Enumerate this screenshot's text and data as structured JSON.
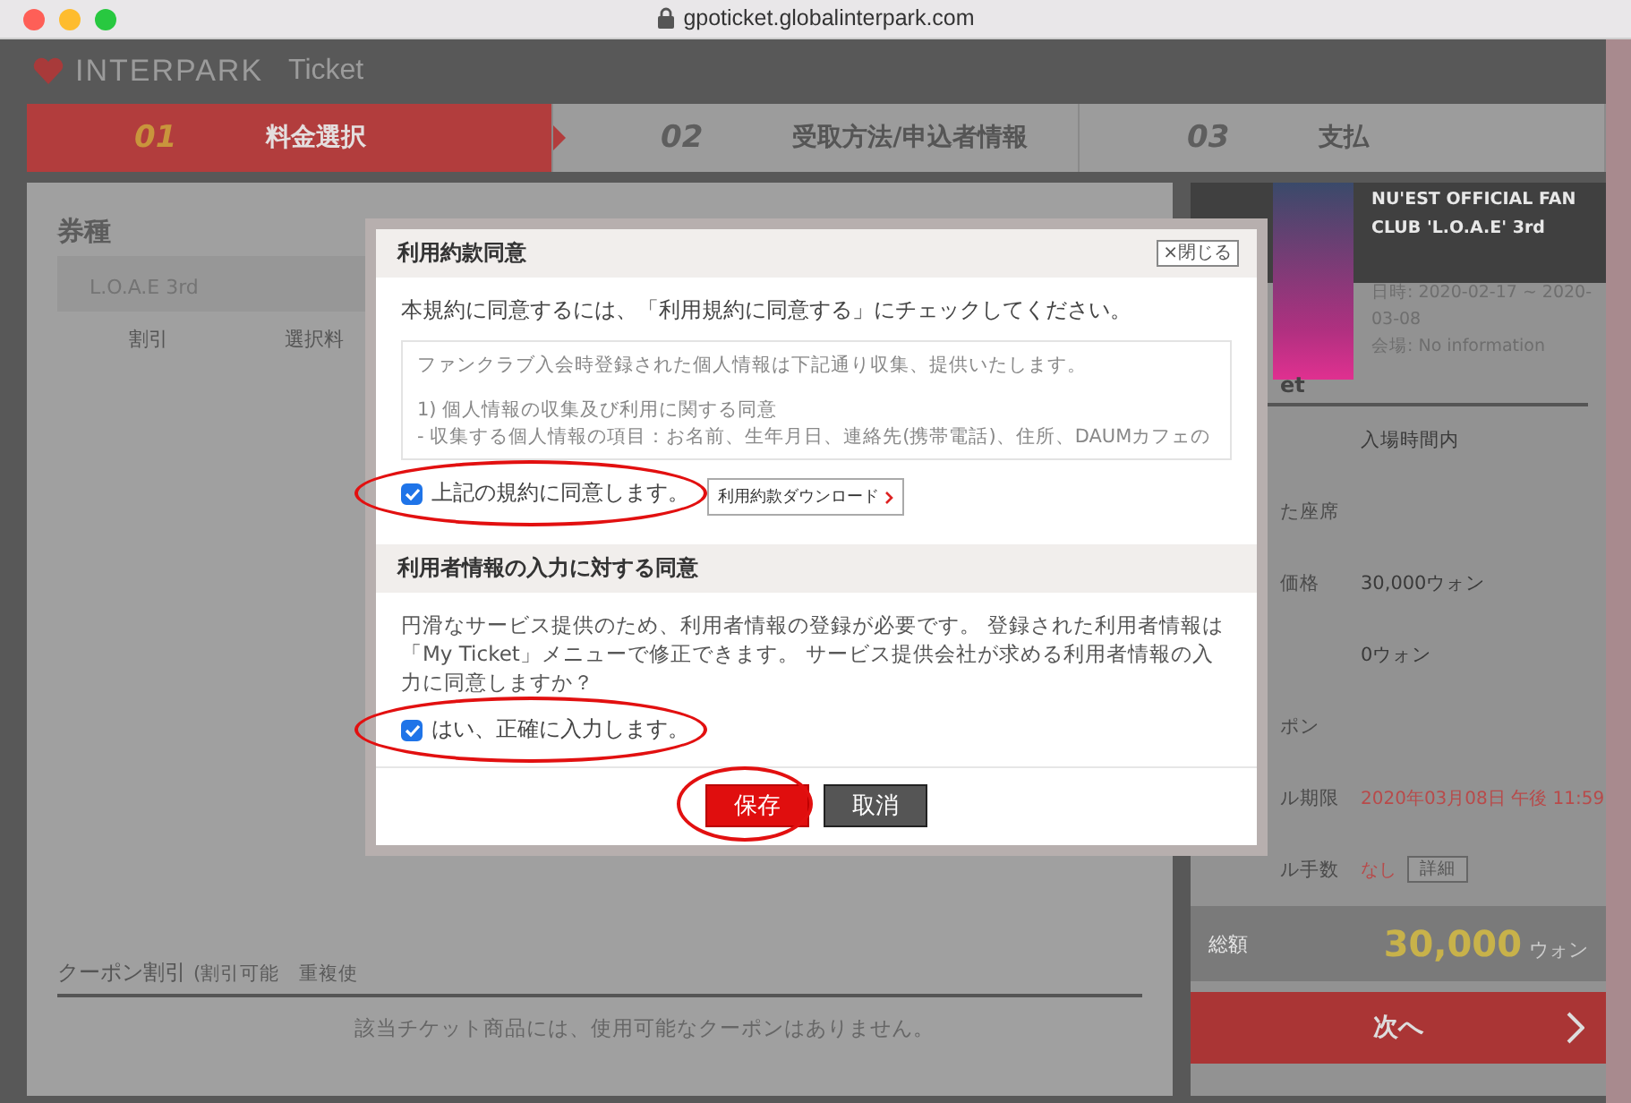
{
  "browser": {
    "url": "gpoticket.globalinterpark.com"
  },
  "header": {
    "logo": "INTERPARK",
    "logo_sub": "Ticket"
  },
  "steps": [
    {
      "number": "01",
      "label": "料金選択",
      "selected": true
    },
    {
      "number": "02",
      "label": "受取方法/申込者情報",
      "selected": false
    },
    {
      "number": "03",
      "label": "支払",
      "selected": false
    }
  ],
  "left_panel": {
    "title": "券種",
    "ticket_type": "L.O.A.E 3rd",
    "columns": [
      "割引",
      "選択料"
    ],
    "coupon": {
      "title": "クーポン割引",
      "note": "(割引可能　重複使",
      "message": "該当チケット商品には、使用可能なクーポンはありません。"
    }
  },
  "right_panel": {
    "event_title": "NU'EST OFFICIAL FAN CLUB 'L.O.A.E' 3rd",
    "date": "日時: 2020-02-17 ~ 2020-03-08",
    "venue": "会場: No information",
    "section_title": "et",
    "rows": [
      {
        "label": "",
        "value": "入場時間内"
      },
      {
        "label": "た座席",
        "value": ""
      },
      {
        "label": "価格",
        "value": "30,000ウォン"
      },
      {
        "label": "",
        "value": "0ウォン"
      },
      {
        "label": "ポン",
        "value": ""
      },
      {
        "label": "ル期限",
        "value": "2020年03月08日 午後 11:59",
        "kind": "alert"
      },
      {
        "label": "ル手数",
        "value": "なし",
        "button": "詳細",
        "kind": "alert"
      }
    ],
    "total": {
      "label": "総額",
      "amount": "30,000",
      "unit": "ウォン"
    },
    "next_button": "次へ"
  },
  "dialog": {
    "title": "利用約款同意",
    "close": "×閉じる",
    "instruction": "本規約に同意するには、「利用規約に同意する」にチェックしてください。",
    "terms": [
      "ファンクラブ入会時登録された個人情報は下記通り収集、提供いたします。",
      "1) 個人情報の収集及び利用に関する同意",
      "- 収集する個人情報の項目：お名前、生年月日、連絡先(携帯電話)、住所、DAUMカフェの"
    ],
    "agree": {
      "label": "上記の規約に同意します。",
      "checked": true,
      "circled": true
    },
    "download": "利用約款ダウンロード",
    "section_title": "利用者情報の入力に対する同意",
    "section_text": "円滑なサービス提供のため、利用者情報の登録が必要です。 登録された利用者情報は「My Ticket」メニューで修正できます。 サービス提供会社が求める利用者情報の入力に同意しますか？",
    "confirm": {
      "label": "はい、正確に入力します。",
      "checked": true,
      "circled": true
    },
    "buttons": [
      {
        "label": "保存",
        "kind": "primary",
        "circled": true
      },
      {
        "label": "取消",
        "kind": "secondary",
        "circled": false
      }
    ]
  }
}
